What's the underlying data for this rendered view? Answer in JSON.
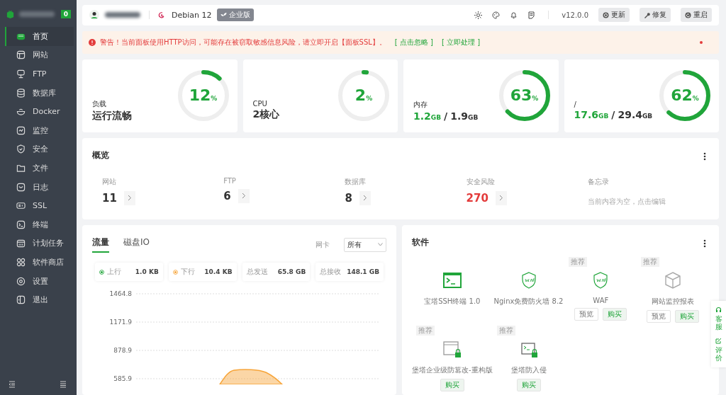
{
  "sidebar": {
    "badge": "0",
    "items": [
      {
        "label": "首页",
        "selected": true
      },
      {
        "label": "网站",
        "selected": false
      },
      {
        "label": "FTP",
        "selected": false
      },
      {
        "label": "数据库",
        "selected": false
      },
      {
        "label": "Docker",
        "selected": false
      },
      {
        "label": "监控",
        "selected": false
      },
      {
        "label": "安全",
        "selected": false
      },
      {
        "label": "文件",
        "selected": false
      },
      {
        "label": "日志",
        "selected": false
      },
      {
        "label": "SSL",
        "selected": false
      },
      {
        "label": "终端",
        "selected": false
      },
      {
        "label": "计划任务",
        "selected": false
      },
      {
        "label": "软件商店",
        "selected": false
      },
      {
        "label": "设置",
        "selected": false
      },
      {
        "label": "退出",
        "selected": false
      }
    ]
  },
  "header": {
    "os": "Debian 12",
    "edition": "企业版",
    "version": "v12.0.0",
    "buttons": [
      "更新",
      "修复",
      "重启"
    ]
  },
  "alert": {
    "message": "警告！当前面板使用HTTP访问，可能存在被窃取敏感信息风险，请立即开启【面板SSL】。",
    "links": [
      "[ 点击忽略 ]",
      "[ 立即处理 ]"
    ]
  },
  "stats": [
    {
      "kind": "text",
      "label": "负载",
      "value": "运行流畅",
      "percent": "12",
      "unit": "%",
      "level": 0.12
    },
    {
      "kind": "text",
      "label": "CPU",
      "value": "2核心",
      "percent": "2",
      "unit": "%",
      "level": 0.02
    },
    {
      "kind": "usage",
      "label": "内存",
      "used": "1.2",
      "used_unit": "GB",
      "separator": "/",
      "total": "1.9",
      "total_unit": "GB",
      "percent": "63",
      "unit": "%",
      "level": 0.63
    },
    {
      "kind": "usage",
      "label": "/",
      "used": "17.6",
      "used_unit": "GB",
      "separator": "/",
      "total": "29.4",
      "total_unit": "GB",
      "percent": "62",
      "unit": "%",
      "level": 0.62
    }
  ],
  "overview": {
    "title": "概览",
    "items": [
      {
        "kind": "count",
        "label": "网站",
        "value": "11",
        "alert": false
      },
      {
        "kind": "count",
        "label": "FTP",
        "value": "6",
        "alert": false
      },
      {
        "kind": "count",
        "label": "数据库",
        "value": "8",
        "alert": false
      },
      {
        "kind": "count",
        "label": "安全风险",
        "value": "270",
        "alert": true
      },
      {
        "kind": "note",
        "label": "备忘录",
        "value": "当前内容为空，点击编辑"
      }
    ]
  },
  "traffic": {
    "tabs": [
      {
        "label": "流量",
        "selected": true
      },
      {
        "label": "磁盘IO",
        "selected": false
      }
    ],
    "select_label": "网卡",
    "select_value": "所有",
    "stats": [
      {
        "label": "上行",
        "value": "1.0 KB",
        "color": "#20a53a"
      },
      {
        "label": "下行",
        "value": "10.4 KB",
        "color": "#f7a53a"
      },
      {
        "label": "总发送",
        "value": "65.8 GB"
      },
      {
        "label": "总接收",
        "value": "148.1 GB"
      }
    ],
    "chart": {
      "y_labels": [
        "1464.8",
        "1171.9",
        "878.9",
        "585.9"
      ]
    }
  },
  "software": {
    "title": "软件",
    "items": [
      {
        "kind": "terminal",
        "name": "宝塔SSH终端 1.0",
        "recommended": false
      },
      {
        "kind": "waf",
        "name": "Nginx免费防火墙 8.2",
        "recommended": false
      },
      {
        "kind": "waf",
        "name": "WAF",
        "recommended": true,
        "tag": "推荐",
        "buttons": [
          {
            "label": "预览",
            "primary": false
          },
          {
            "label": "购买",
            "primary": true
          }
        ]
      },
      {
        "kind": "cube",
        "name": "网站监控报表",
        "recommended": true,
        "tag": "推荐",
        "buttons": [
          {
            "label": "预览",
            "primary": false
          },
          {
            "label": "购买",
            "primary": true
          }
        ]
      },
      {
        "kind": "lock-window",
        "name": "堡塔企业级防篡改-重构版",
        "recommended": true,
        "tag": "推荐",
        "buttons": [
          {
            "label": "购买",
            "primary": true
          }
        ]
      },
      {
        "kind": "lock-terminal",
        "name": "堡塔防入侵",
        "recommended": true,
        "tag": "推荐",
        "buttons": [
          {
            "label": "购买",
            "primary": true
          }
        ]
      }
    ]
  },
  "float_panel": [
    "客服",
    "评价"
  ]
}
